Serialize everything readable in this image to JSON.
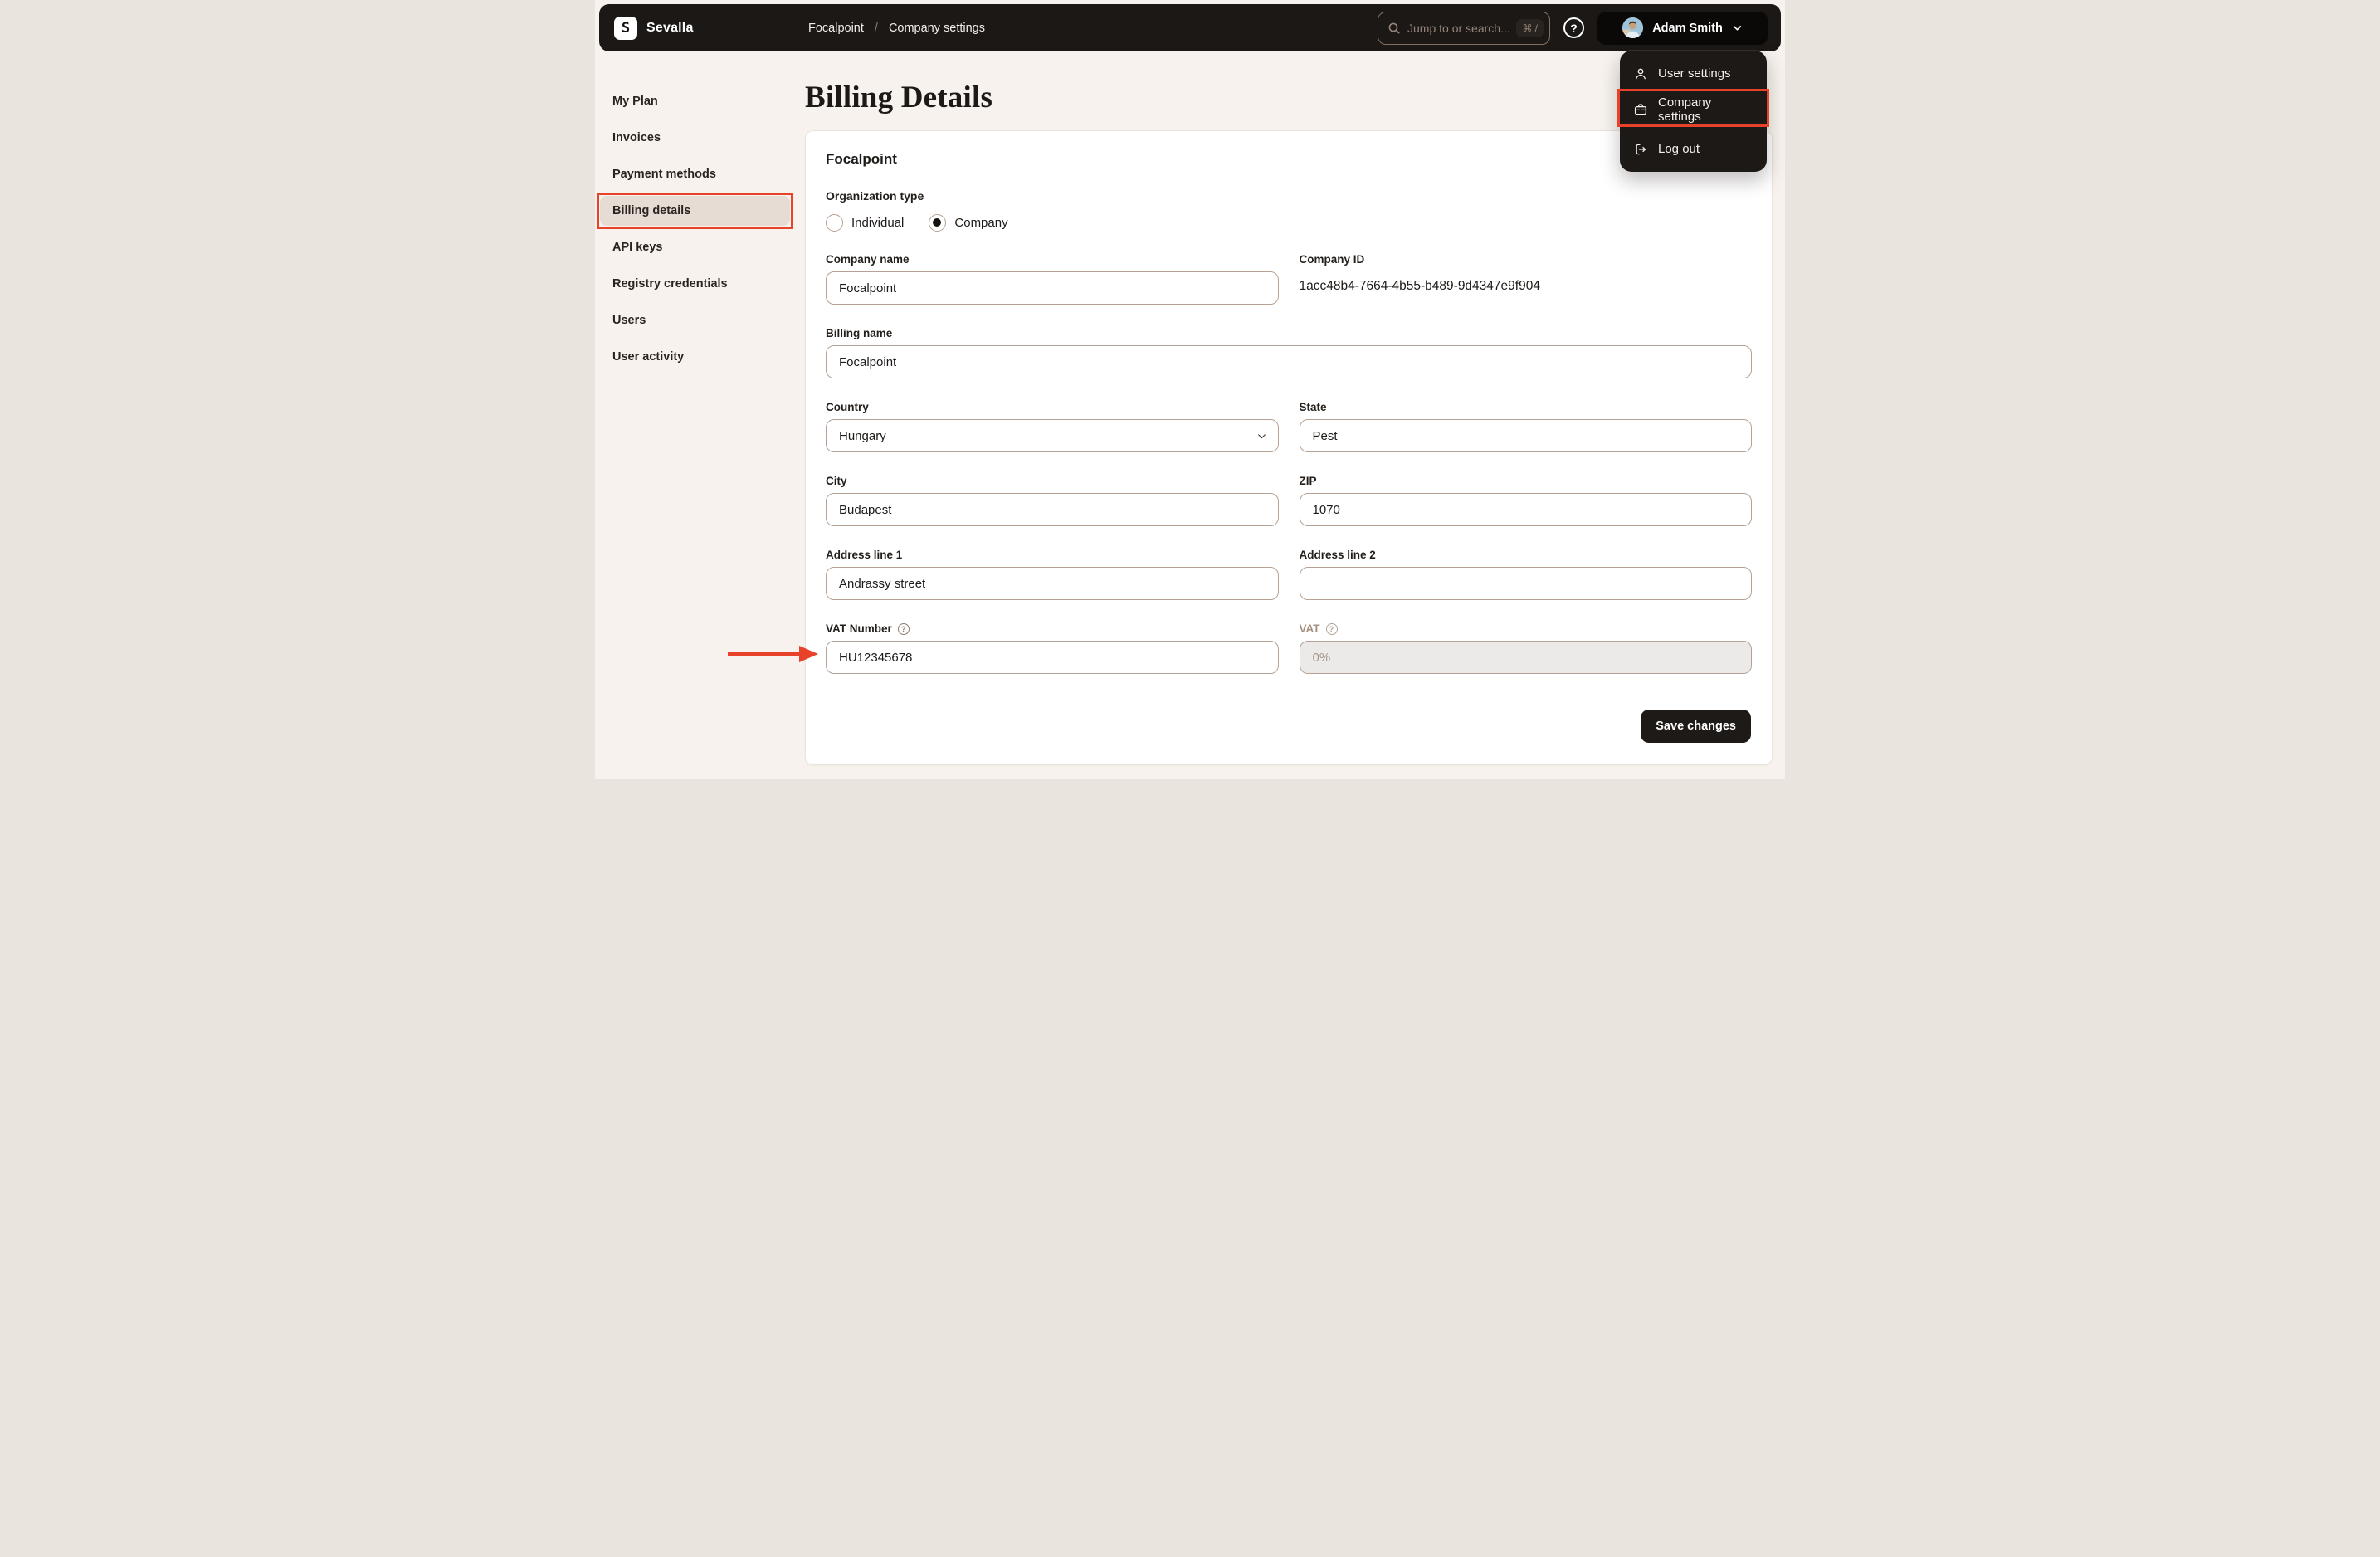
{
  "topbar": {
    "brand": "Sevalla",
    "breadcrumb": {
      "project": "Focalpoint",
      "separator": "/",
      "current": "Company settings"
    },
    "search": {
      "placeholder": "Jump to or search...",
      "shortcut": "⌘ /"
    },
    "help_glyph": "?",
    "user": {
      "name": "Adam Smith"
    }
  },
  "user_menu": {
    "items": [
      {
        "label": "User settings",
        "icon": "user-icon",
        "highlighted": false
      },
      {
        "label": "Company settings",
        "icon": "briefcase-icon",
        "highlighted": true
      },
      {
        "label": "Log out",
        "icon": "logout-icon",
        "highlighted": false
      }
    ]
  },
  "sidebar": {
    "items": [
      {
        "label": "My Plan",
        "active": false
      },
      {
        "label": "Invoices",
        "active": false
      },
      {
        "label": "Payment methods",
        "active": false
      },
      {
        "label": "Billing details",
        "active": true,
        "highlighted": true
      },
      {
        "label": "API keys",
        "active": false
      },
      {
        "label": "Registry credentials",
        "active": false
      },
      {
        "label": "Users",
        "active": false
      },
      {
        "label": "User activity",
        "active": false
      }
    ]
  },
  "page": {
    "title": "Billing Details"
  },
  "card": {
    "title": "Focalpoint",
    "organization_type": {
      "label": "Organization type",
      "options": [
        {
          "label": "Individual",
          "selected": false
        },
        {
          "label": "Company",
          "selected": true
        }
      ]
    },
    "fields": {
      "company_name": {
        "label": "Company name",
        "value": "Focalpoint"
      },
      "company_id": {
        "label": "Company ID",
        "value": "1acc48b4-7664-4b55-b489-9d4347e9f904"
      },
      "billing_name": {
        "label": "Billing name",
        "value": "Focalpoint"
      },
      "country": {
        "label": "Country",
        "value": "Hungary"
      },
      "state": {
        "label": "State",
        "value": "Pest"
      },
      "city": {
        "label": "City",
        "value": "Budapest"
      },
      "zip": {
        "label": "ZIP",
        "value": "1070"
      },
      "address_line_1": {
        "label": "Address line 1",
        "value": "Andrassy street"
      },
      "address_line_2": {
        "label": "Address line 2",
        "value": ""
      },
      "vat_number": {
        "label": "VAT Number",
        "value": "HU12345678",
        "help_glyph": "?"
      },
      "vat": {
        "label": "VAT",
        "value": "0%",
        "disabled": true,
        "help_glyph": "?"
      }
    },
    "save_label": "Save changes"
  },
  "annotations": {
    "color": "#E8432A",
    "sidebar_highlight": "Billing details",
    "menu_highlight": "Company settings",
    "arrow_points_to": "VAT Number field"
  },
  "colors": {
    "page_bg": "#F7F2ED",
    "topbar_bg": "#1B1816",
    "card_bg": "#FFFFFF",
    "input_border": "#B5A294",
    "sidebar_active_bg": "#E6DCD3",
    "primary_button_bg": "#1D1A17",
    "disabled_input_bg": "#ECEAE8",
    "accent_red": "#E8432A"
  }
}
